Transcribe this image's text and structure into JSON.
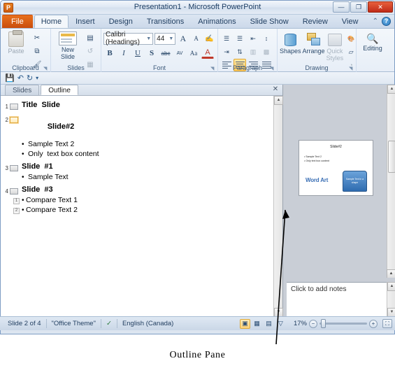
{
  "window": {
    "title": "Presentation1 - Microsoft PowerPoint",
    "app_logo": "P",
    "minimize": "—",
    "maximize": "❐",
    "close": "✕"
  },
  "ribbon": {
    "tabs": [
      {
        "label": "File",
        "type": "file"
      },
      {
        "label": "Home",
        "type": "active"
      },
      {
        "label": "Insert",
        "type": "normal"
      },
      {
        "label": "Design",
        "type": "normal"
      },
      {
        "label": "Transitions",
        "type": "normal"
      },
      {
        "label": "Animations",
        "type": "normal"
      },
      {
        "label": "Slide Show",
        "type": "normal"
      },
      {
        "label": "Review",
        "type": "normal"
      },
      {
        "label": "View",
        "type": "normal"
      }
    ],
    "minimize_ribbon_icon": "⌃",
    "help_icon": "?",
    "groups": {
      "clipboard": {
        "label": "Clipboard",
        "paste_label": "Paste",
        "cut_icon": "✂",
        "copy_icon": "⧉",
        "format_painter_icon": "🖌",
        "dialog_launcher": "◥"
      },
      "slides": {
        "label": "Slides",
        "new_slide_label": "New\nSlide",
        "layout_icon": "▤",
        "reset_icon": "↺",
        "section_icon": "▦"
      },
      "font": {
        "label": "Font",
        "font_name": "Calibri (Headings)",
        "font_size": "44",
        "grow_font": "A",
        "shrink_font": "A",
        "clear_formatting": "✍",
        "bold": "B",
        "italic": "I",
        "underline": "U",
        "shadow": "S",
        "strikethrough": "abc",
        "character_spacing": "AV",
        "change_case": "Aa",
        "font_color": "A",
        "dialog_launcher": "◥"
      },
      "paragraph": {
        "label": "Paragraph",
        "bullets": "☰",
        "numbering": "☰",
        "decrease_indent": "⇤",
        "increase_indent": "⇥",
        "line_spacing": "↕",
        "text_direction": "⇅",
        "align_text": "▥",
        "convert_smartart": "▩",
        "align_left": "▤",
        "align_center": "▤",
        "align_right": "▤",
        "justify": "▤",
        "columns": "▥",
        "dialog_launcher": "◥"
      },
      "drawing": {
        "label": "Drawing",
        "shapes_label": "Shapes",
        "arrange_label": "Arrange",
        "quick_styles_label": "Quick\nStyles",
        "shape_fill": "🎨",
        "shape_outline": "▱",
        "shape_effects": "◔",
        "dialog_launcher": "◥"
      },
      "editing": {
        "label": "Editing",
        "editing_label": "Editing",
        "find_icon": "🔍"
      }
    }
  },
  "quick_access": {
    "save_icon": "💾",
    "undo_icon": "↶",
    "redo_icon": "↻",
    "customize_icon": "▾"
  },
  "outline_pane": {
    "tabs": [
      {
        "label": "Slides",
        "active": false
      },
      {
        "label": "Outline",
        "active": true
      }
    ],
    "close_icon": "✕",
    "scroll_up_icon": "▲",
    "scroll_down_icon": "▼",
    "slides": [
      {
        "number": "1",
        "title": "Title  Slide",
        "selected": false,
        "has_caret": false,
        "bullets": []
      },
      {
        "number": "2",
        "title": "Slide#2",
        "selected": true,
        "has_caret": true,
        "bullets": [
          {
            "text": "Sample Text 2",
            "collapse": false
          },
          {
            "text": "Only  text box content",
            "collapse": false
          }
        ]
      },
      {
        "number": "3",
        "title": "Slide  #1",
        "selected": false,
        "has_caret": false,
        "bullets": [
          {
            "text": "Sample Text",
            "collapse": false
          }
        ]
      },
      {
        "number": "4",
        "title": "Slide  #3",
        "selected": false,
        "has_caret": false,
        "bullets": [
          {
            "text": "Compare Text 1",
            "collapse": true,
            "collapse_label": "1"
          },
          {
            "text": "Compare Text 2",
            "collapse": true,
            "collapse_label": "2"
          }
        ]
      }
    ]
  },
  "slide_preview": {
    "title": "Slide#2",
    "bullet1": "• Sample Text 2",
    "bullet2": "• Only text box content",
    "wordart": "Word Art",
    "shape_text": "Sample Text in a shape",
    "shape_color": "#2f6cb0",
    "wordart_color": "#3a6fb5",
    "prev_slide_icon": "▲",
    "next_slide_icon": "▼",
    "scroll_top_icon": "▲"
  },
  "notes_pane": {
    "placeholder": "Click to add notes",
    "scroll_up_icon": "▲",
    "scroll_down_icon": "▼"
  },
  "status_bar": {
    "slide_count": "Slide 2 of 4",
    "theme": "\"Office Theme\"",
    "spell_icon": "✓",
    "language": "English (Canada)",
    "view_normal": "▣",
    "view_sorter": "▦",
    "view_reading": "▤",
    "view_slideshow": "▽",
    "zoom_percent": "17%",
    "zoom_out": "−",
    "zoom_in": "+",
    "fit_to_window": "⛶"
  },
  "annotation": {
    "label": "Outline Pane",
    "arrow_color": "#000000"
  }
}
